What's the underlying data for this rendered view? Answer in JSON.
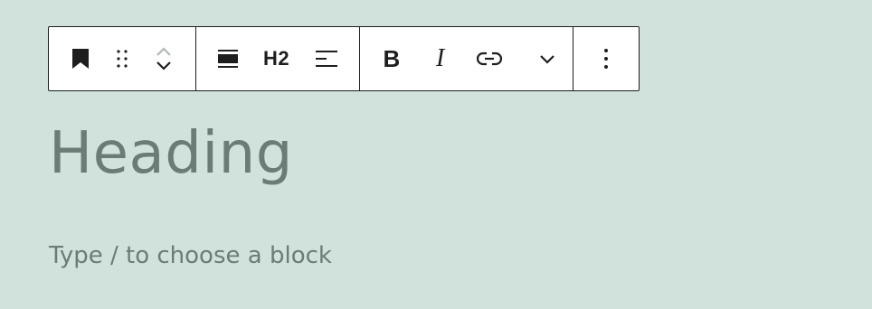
{
  "toolbar": {
    "icons": {
      "block_type": "bookmark-icon",
      "drag": "drag-handle-icon",
      "move_up": "chevron-up-icon",
      "move_down": "chevron-down-icon",
      "align": "align-wide-icon",
      "text_align": "align-left-icon",
      "bold": "bold-icon",
      "italic": "italic-icon",
      "link": "link-icon",
      "more_formatting": "chevron-down-icon",
      "options": "more-vertical-icon"
    },
    "heading_level_label": "H2",
    "bold_label": "B",
    "italic_label": "I"
  },
  "editor": {
    "heading_text": "Heading",
    "block_placeholder": "Type / to choose a block"
  },
  "colors": {
    "background": "#d1e2dc",
    "toolbar_border": "#1e1e1e",
    "icon": "#1e1e1e",
    "heading_text": "#6b7b76",
    "disabled_icon": "#b0b8b4"
  }
}
